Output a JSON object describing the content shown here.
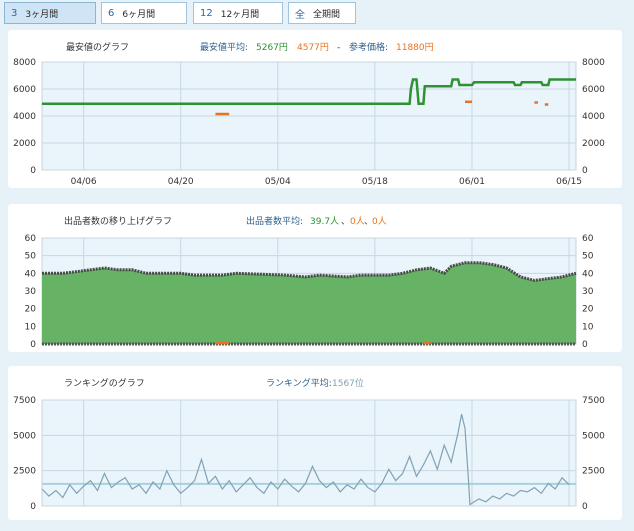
{
  "tabs": [
    {
      "num": "3",
      "label": "3ヶ月間"
    },
    {
      "num": "6",
      "label": "6ヶ月間"
    },
    {
      "num": "12",
      "label": "12ヶ月間"
    },
    {
      "num": "全",
      "label": "全期間"
    }
  ],
  "colors": {
    "green": "#2e9133",
    "orange": "#e8731f",
    "blue_series": "#7fa3b5",
    "plot_bg": "#eaf4fb",
    "grid": "#c9d7e2",
    "area_fill": "#66b366",
    "area_line": "#4a4a4a"
  },
  "charts": {
    "price": {
      "title": "最安値のグラフ",
      "avg_label": "最安値平均:",
      "avg_value": "5267円",
      "orange_value": "4577円",
      "separator": "-",
      "ref_label": "参考価格:",
      "ref_value": "11880円"
    },
    "sellers": {
      "title": "出品者数の移り上げグラフ",
      "avg_label": "出品者数平均:",
      "avg_value": "39.7人",
      "sep1": "、",
      "orange_value": "0人",
      "sep2": "、",
      "other_value": "0人"
    },
    "ranking": {
      "title": "ランキングのグラフ",
      "avg_label": "ランキング平均:",
      "avg_value": "1567位"
    }
  },
  "chart_data": [
    {
      "type": "line",
      "x_ticks": [
        "04/06",
        "04/20",
        "05/04",
        "05/18",
        "06/01",
        "06/15"
      ],
      "ylim": [
        0,
        8000
      ],
      "y_ticks": [
        "0",
        "2000",
        "4000",
        "6000",
        "8000"
      ],
      "series": [
        {
          "color": "#2e9133",
          "points": [
            [
              0,
              4900
            ],
            [
              53,
              4900
            ],
            [
              53.2,
              6000
            ],
            [
              53.5,
              6700
            ],
            [
              54,
              6700
            ],
            [
              54.3,
              4900
            ],
            [
              55,
              4900
            ],
            [
              55.2,
              6200
            ],
            [
              59,
              6200
            ],
            [
              59.2,
              6700
            ],
            [
              60,
              6700
            ],
            [
              60.2,
              6300
            ],
            [
              62,
              6300
            ],
            [
              62.3,
              6500
            ],
            [
              68,
              6500
            ],
            [
              68.2,
              6300
            ],
            [
              69,
              6300
            ],
            [
              69.2,
              6500
            ],
            [
              72,
              6500
            ],
            [
              72.2,
              6300
            ],
            [
              73,
              6300
            ],
            [
              73.2,
              6700
            ],
            [
              77,
              6700
            ]
          ]
        },
        {
          "color": "#e8731f",
          "points": [
            [
              25,
              4150
            ],
            [
              27,
              4150
            ]
          ]
        },
        {
          "color": "#e8731f",
          "points": [
            [
              61,
              5050
            ],
            [
              62,
              5050
            ]
          ]
        },
        {
          "color": "#e8731f",
          "points": [
            [
              71,
              5000
            ],
            [
              71.5,
              5000
            ]
          ]
        },
        {
          "color": "#e8731f",
          "points": [
            [
              72.5,
              4850
            ],
            [
              73,
              4850
            ]
          ]
        }
      ]
    },
    {
      "type": "area",
      "x_ticks": [],
      "ylim": [
        0,
        60
      ],
      "y_ticks": [
        "0",
        "10",
        "20",
        "30",
        "40",
        "50",
        "60"
      ],
      "series": [
        {
          "color": "#4a4a4a",
          "points": [
            [
              0,
              40
            ],
            [
              3,
              40
            ],
            [
              5,
              41
            ],
            [
              7,
              42
            ],
            [
              9,
              43
            ],
            [
              11,
              42
            ],
            [
              13,
              42
            ],
            [
              15,
              40
            ],
            [
              20,
              40
            ],
            [
              22,
              39
            ],
            [
              26,
              39
            ],
            [
              28,
              40
            ],
            [
              35,
              39
            ],
            [
              38,
              38
            ],
            [
              40,
              39
            ],
            [
              44,
              38
            ],
            [
              46,
              39
            ],
            [
              50,
              39
            ],
            [
              52,
              40
            ],
            [
              54,
              42
            ],
            [
              56,
              43
            ],
            [
              58,
              40
            ],
            [
              59,
              44
            ],
            [
              61,
              46
            ],
            [
              63,
              46
            ],
            [
              65,
              45
            ],
            [
              67,
              43
            ],
            [
              69,
              38
            ],
            [
              71,
              36
            ],
            [
              73,
              37
            ],
            [
              75,
              38
            ],
            [
              77,
              40
            ]
          ]
        },
        {
          "color": "#e8731f",
          "points": [
            [
              25,
              0.5
            ],
            [
              27,
              0.5
            ]
          ]
        },
        {
          "color": "#e8731f",
          "points": [
            [
              55,
              0.5
            ],
            [
              56,
              0.5
            ]
          ]
        }
      ]
    },
    {
      "type": "line",
      "x_ticks": [],
      "ylim": [
        0,
        7500
      ],
      "y_ticks": [
        "0",
        "2500",
        "5000",
        "7500"
      ],
      "avg": 1567,
      "series": [
        {
          "color": "#7fa3b5",
          "points": [
            [
              0,
              1200
            ],
            [
              1,
              700
            ],
            [
              2,
              1100
            ],
            [
              3,
              600
            ],
            [
              4,
              1500
            ],
            [
              5,
              900
            ],
            [
              6,
              1400
            ],
            [
              7,
              1800
            ],
            [
              8,
              1100
            ],
            [
              9,
              2300
            ],
            [
              10,
              1300
            ],
            [
              11,
              1700
            ],
            [
              12,
              2000
            ],
            [
              13,
              1200
            ],
            [
              14,
              1500
            ],
            [
              15,
              900
            ],
            [
              16,
              1700
            ],
            [
              17,
              1200
            ],
            [
              18,
              2500
            ],
            [
              19,
              1500
            ],
            [
              20,
              900
            ],
            [
              21,
              1300
            ],
            [
              22,
              1800
            ],
            [
              23,
              3300
            ],
            [
              24,
              1600
            ],
            [
              25,
              2100
            ],
            [
              26,
              1200
            ],
            [
              27,
              1800
            ],
            [
              28,
              1000
            ],
            [
              29,
              1500
            ],
            [
              30,
              2000
            ],
            [
              31,
              1300
            ],
            [
              32,
              900
            ],
            [
              33,
              1700
            ],
            [
              34,
              1200
            ],
            [
              35,
              1900
            ],
            [
              36,
              1400
            ],
            [
              37,
              1000
            ],
            [
              38,
              1600
            ],
            [
              39,
              2800
            ],
            [
              40,
              1800
            ],
            [
              41,
              1300
            ],
            [
              42,
              1700
            ],
            [
              43,
              1000
            ],
            [
              44,
              1500
            ],
            [
              45,
              1200
            ],
            [
              46,
              1900
            ],
            [
              47,
              1300
            ],
            [
              48,
              1000
            ],
            [
              49,
              1600
            ],
            [
              50,
              2600
            ],
            [
              51,
              1800
            ],
            [
              52,
              2300
            ],
            [
              53,
              3500
            ],
            [
              54,
              2100
            ],
            [
              55,
              2900
            ],
            [
              56,
              3900
            ],
            [
              57,
              2600
            ],
            [
              58,
              4300
            ],
            [
              59,
              3100
            ],
            [
              60,
              5200
            ],
            [
              60.5,
              6500
            ],
            [
              61,
              5500
            ],
            [
              61.5,
              1800
            ],
            [
              61.7,
              100
            ],
            [
              62,
              200
            ],
            [
              63,
              500
            ],
            [
              64,
              300
            ],
            [
              65,
              700
            ],
            [
              66,
              500
            ],
            [
              67,
              900
            ],
            [
              68,
              700
            ],
            [
              69,
              1100
            ],
            [
              70,
              1000
            ],
            [
              71,
              1300
            ],
            [
              72,
              900
            ],
            [
              73,
              1600
            ],
            [
              74,
              1200
            ],
            [
              75,
              2000
            ],
            [
              76,
              1500
            ]
          ]
        }
      ]
    }
  ]
}
